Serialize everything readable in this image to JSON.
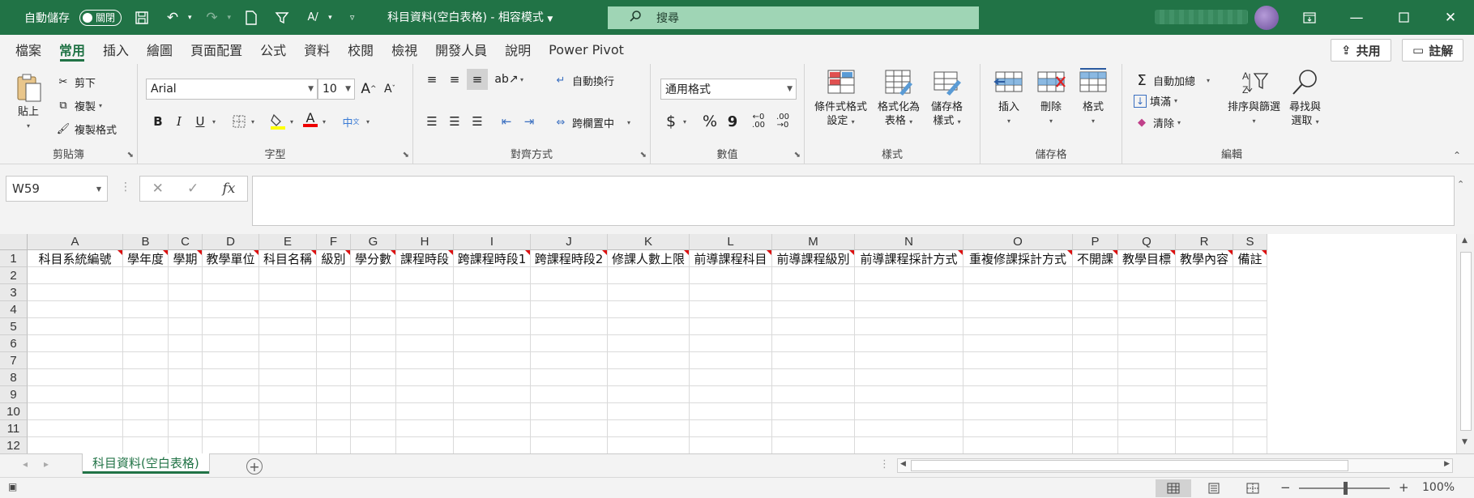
{
  "titlebar": {
    "autosave_label": "自動儲存",
    "autosave_state": "關閉",
    "doc_title": "科目資料(空白表格)  -  相容模式",
    "search_label": "搜尋"
  },
  "menu": {
    "tabs": [
      "檔案",
      "常用",
      "插入",
      "繪圖",
      "頁面配置",
      "公式",
      "資料",
      "校閱",
      "檢視",
      "開發人員",
      "說明",
      "Power Pivot"
    ],
    "active": "常用",
    "share_label": "共用",
    "comment_label": "註解"
  },
  "ribbon": {
    "clipboard": {
      "label": "剪貼簿",
      "paste": "貼上",
      "cut": "剪下",
      "copy": "複製",
      "format_painter": "複製格式"
    },
    "font": {
      "label": "字型",
      "font_name": "Arial",
      "font_size": "10",
      "bold": "B",
      "italic": "I",
      "underline": "U",
      "grow": "A",
      "shrink": "A",
      "font_color_letter": "A",
      "phonetic": "中"
    },
    "alignment": {
      "label": "對齊方式",
      "wrap": "自動換行",
      "merge": "跨欄置中"
    },
    "number": {
      "label": "數值",
      "format": "通用格式",
      "currency": "$",
      "percent": "%",
      "comma": "9",
      "inc_dec": ".00",
      "dec_dec": ".00"
    },
    "styles": {
      "label": "樣式",
      "conditional": [
        "條件式格式",
        "設定"
      ],
      "as_table": [
        "格式化為",
        "表格"
      ],
      "cell_styles": [
        "儲存格",
        "樣式"
      ]
    },
    "cells": {
      "label": "儲存格",
      "insert": "插入",
      "delete": "刪除",
      "format": "格式"
    },
    "editing": {
      "label": "編輯",
      "autosum": "自動加總",
      "fill": "填滿",
      "clear": "清除",
      "sort_filter": "排序與篩選",
      "find_select": [
        "尋找與",
        "選取"
      ]
    }
  },
  "formula_bar": {
    "name_box": "W59",
    "fx": "fx",
    "content": ""
  },
  "grid": {
    "columns": [
      "A",
      "B",
      "C",
      "D",
      "E",
      "F",
      "G",
      "H",
      "I",
      "J",
      "K",
      "L",
      "M",
      "N",
      "O",
      "P",
      "Q",
      "R",
      "S"
    ],
    "header_row": [
      "科目系統編號",
      "學年度",
      "學期",
      "教學單位",
      "科目名稱",
      "級別",
      "學分數",
      "課程時段",
      "跨課程時段1",
      "跨課程時段2",
      "修課人數上限",
      "前導課程科目",
      "前導課程級別",
      "前導課程採計方式",
      "重複修課採計方式",
      "不開課",
      "教學目標",
      "教學內容",
      "備註"
    ],
    "rows": [
      "1",
      "2",
      "3",
      "4",
      "5",
      "6",
      "7",
      "8",
      "9",
      "10",
      "11",
      "12"
    ]
  },
  "sheet_tabs": {
    "active": "科目資料(空白表格)"
  },
  "status": {
    "zoom": "100%"
  },
  "colors": {
    "accent": "#217346",
    "comment_marker": "#dd1111"
  }
}
